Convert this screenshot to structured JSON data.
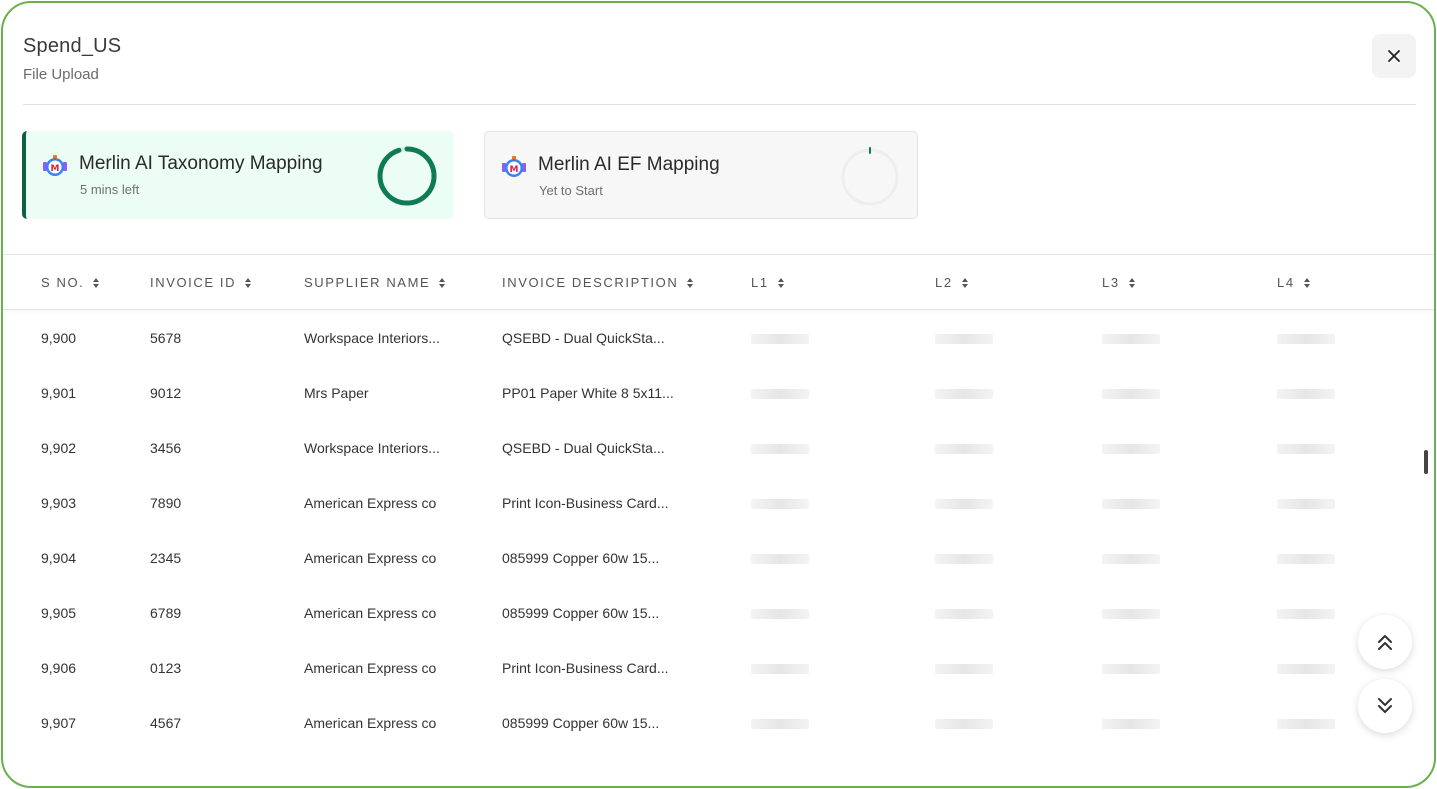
{
  "header": {
    "title": "Spend_US",
    "subtitle": "File Upload"
  },
  "cards": [
    {
      "title": "Merlin AI Taxonomy Mapping",
      "status": "5 mins left",
      "progress": 0.95,
      "accent": "#0e7a56"
    },
    {
      "title": "Merlin AI EF Mapping",
      "status": "Yet to Start",
      "progress": 0.0,
      "accent": "#0e7a56"
    }
  ],
  "table": {
    "columns": [
      "S NO.",
      "INVOICE ID",
      "SUPPLIER NAME",
      "INVOICE DESCRIPTION",
      "L1",
      "L2",
      "L3",
      "L4"
    ],
    "rows": [
      [
        "9,900",
        "5678",
        "Workspace Interiors...",
        "QSEBD - Dual QuickSta..."
      ],
      [
        "9,901",
        "9012",
        "Mrs Paper",
        "PP01 Paper White 8 5x11..."
      ],
      [
        "9,902",
        "3456",
        "Workspace Interiors...",
        "QSEBD - Dual QuickSta..."
      ],
      [
        "9,903",
        "7890",
        "American Express co",
        "Print Icon-Business Card..."
      ],
      [
        "9,904",
        "2345",
        "American Express co",
        "085999 Copper 60w 15..."
      ],
      [
        "9,905",
        "6789",
        "American Express co",
        "085999 Copper 60w 15..."
      ],
      [
        "9,906",
        "0123",
        "American Express co",
        "Print Icon-Business Card..."
      ],
      [
        "9,907",
        "4567",
        "American Express co",
        "085999 Copper 60w 15..."
      ]
    ]
  },
  "colors": {
    "frame_border": "#6ab04c",
    "active_card_bg": "#ecfdf5",
    "active_card_accent": "#0e5f43"
  },
  "icons": {
    "close": "close-icon",
    "sort": "sort-icon",
    "logo": "merlin-logo-icon",
    "scroll_up": "double-chevron-up-icon",
    "scroll_down": "double-chevron-down-icon"
  }
}
